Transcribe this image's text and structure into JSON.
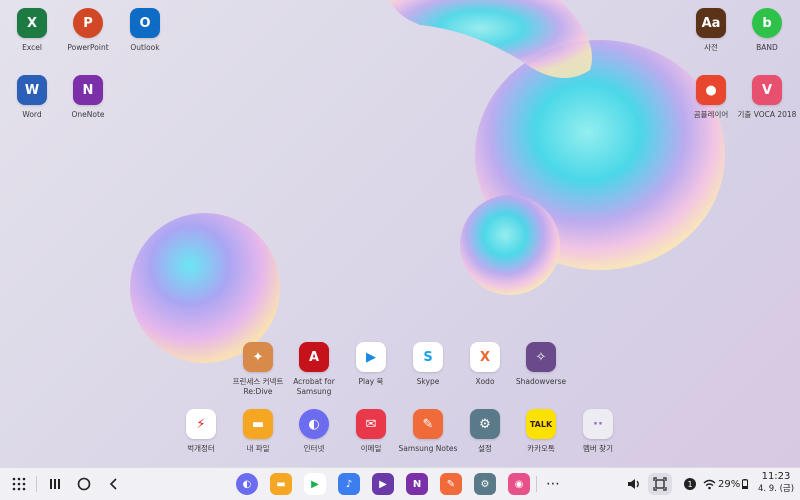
{
  "desktop_left": [
    {
      "label": "Excel",
      "color": "#1d7a43",
      "glyph": "X"
    },
    {
      "label": "PowerPoint",
      "color": "#d24726",
      "glyph": "P"
    },
    {
      "label": "Outlook",
      "color": "#0f6cc4",
      "glyph": "O"
    },
    {
      "label": "Word",
      "color": "#2b5fb8",
      "glyph": "W"
    },
    {
      "label": "OneNote",
      "color": "#7b2fa8",
      "glyph": "N"
    }
  ],
  "desktop_right": [
    {
      "label": "사전",
      "color": "#5a3318",
      "glyph": "Aa"
    },
    {
      "label": "BAND",
      "color": "#2fc24a",
      "glyph": "b"
    },
    {
      "label": "곰플레이어",
      "color": "#e8462f",
      "glyph": "●"
    },
    {
      "label": "기출 VOCA 2018",
      "color": "#e85070",
      "glyph": "V"
    }
  ],
  "dock_row1": [
    {
      "label": "프린세스 커넥트 Re:Dive",
      "color": "#d88a4a",
      "glyph": "✦"
    },
    {
      "label": "Acrobat for Samsung",
      "color": "#c6121b",
      "glyph": "A"
    },
    {
      "label": "Play 북",
      "color": "#ffffff",
      "glyph": "▶"
    },
    {
      "label": "Skype",
      "color": "#ffffff",
      "glyph": "S"
    },
    {
      "label": "Xodo",
      "color": "#ffffff",
      "glyph": "X"
    },
    {
      "label": "Shadowverse",
      "color": "#6a4a8a",
      "glyph": "✧"
    }
  ],
  "dock_row2": [
    {
      "label": "벅개정터",
      "color": "#ffffff",
      "glyph": "⚡"
    },
    {
      "label": "내 파일",
      "color": "#f5a623",
      "glyph": "▬"
    },
    {
      "label": "인터넷",
      "color": "#6c6cf0",
      "glyph": "◐"
    },
    {
      "label": "이메일",
      "color": "#e8384a",
      "glyph": "✉"
    },
    {
      "label": "Samsung Notes",
      "color": "#f06a3a",
      "glyph": "✎"
    },
    {
      "label": "설정",
      "color": "#5a7a8a",
      "glyph": "⚙"
    },
    {
      "label": "카카오톡",
      "color": "#fae100",
      "glyph": "TALK"
    },
    {
      "label": "멤버 찾기",
      "color": "#ececf2",
      "glyph": "··"
    }
  ],
  "taskbar": {
    "pinned": [
      {
        "name": "internet",
        "color": "#6c6cf0",
        "glyph": "◐"
      },
      {
        "name": "my-files",
        "color": "#f5a623",
        "glyph": "▬"
      },
      {
        "name": "play-store",
        "color": "#ffffff",
        "glyph": "▶"
      },
      {
        "name": "music",
        "color": "#3c7ef0",
        "glyph": "♪"
      },
      {
        "name": "video",
        "color": "#6a3aa8",
        "glyph": "▶"
      },
      {
        "name": "onenote",
        "color": "#7b2fa8",
        "glyph": "N"
      },
      {
        "name": "samsung-notes",
        "color": "#f06a3a",
        "glyph": "✎"
      },
      {
        "name": "settings",
        "color": "#5a7a8a",
        "glyph": "⚙"
      },
      {
        "name": "gallery",
        "color": "#e8508a",
        "glyph": "◉"
      }
    ],
    "battery": "29%",
    "time": "11:23",
    "date": "4. 9. (금)",
    "notification_count": "1"
  }
}
